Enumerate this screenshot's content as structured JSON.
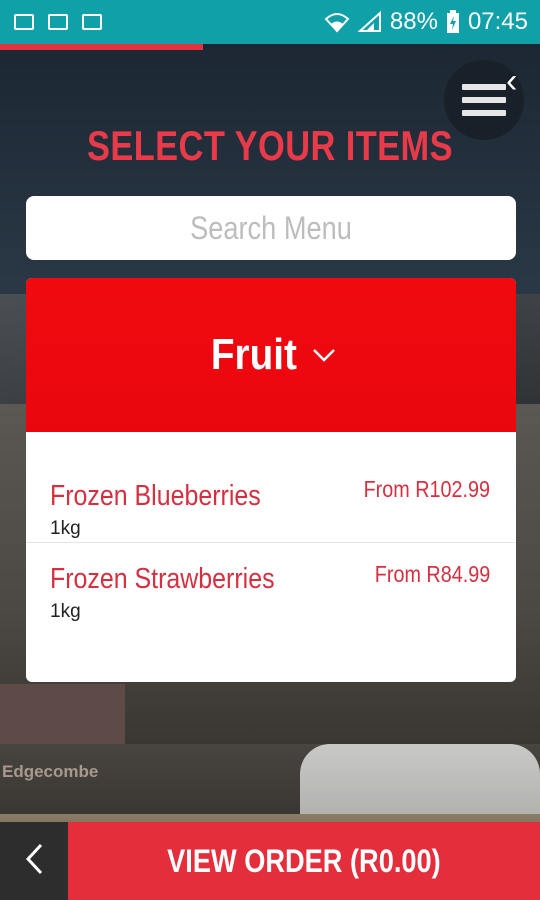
{
  "status_bar": {
    "battery": "88%",
    "time": "07:45",
    "left_icons": [
      "image-icon",
      "mail-icon",
      "browser-icon"
    ],
    "right_icons": [
      "wifi-icon",
      "signal-icon",
      "battery-charging-icon"
    ]
  },
  "header": {
    "title": "SELECT YOUR ITEMS",
    "menu_icon": "hamburger-icon",
    "menu_close_glyph": "‹"
  },
  "search": {
    "placeholder": "Search Menu",
    "value": ""
  },
  "category": {
    "name": "Fruit",
    "icon": "chevron-down-icon",
    "color": "#f00a10"
  },
  "items": [
    {
      "name": "Frozen Blueberries",
      "size": "1kg",
      "price": "From R102.99"
    },
    {
      "name": "Frozen Strawberries",
      "size": "1kg",
      "price": "From R84.99"
    }
  ],
  "bottom_bar": {
    "back_icon": "chevron-left-icon",
    "view_order_label": "VIEW ORDER (R0.00)"
  },
  "background": {
    "sign_text": "Edgecombe"
  },
  "colors": {
    "status_bar": "#0fa0a8",
    "accent": "#e83a48",
    "button": "#e42e3b"
  }
}
